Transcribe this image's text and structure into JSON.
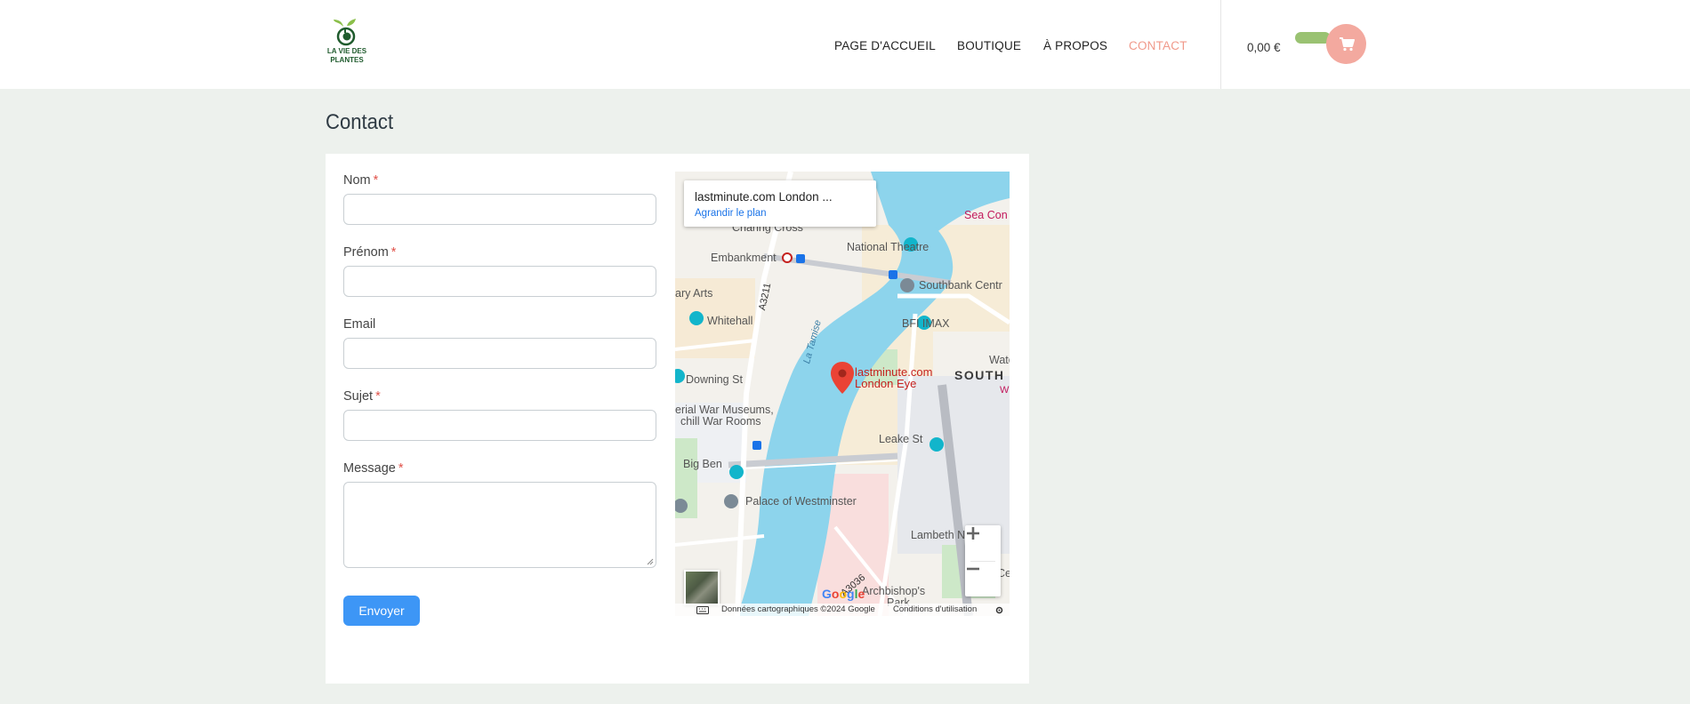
{
  "header": {
    "logo": {
      "line1": "LA VIE DES",
      "line2": "PLANTES"
    },
    "nav": [
      {
        "label": "PAGE D'ACCUEIL",
        "active": false
      },
      {
        "label": "BOUTIQUE",
        "active": false
      },
      {
        "label": "À PROPOS",
        "active": false
      },
      {
        "label": "CONTACT",
        "active": true
      }
    ],
    "cart_total": "0,00 €",
    "cart_icon": "shopping-cart-icon"
  },
  "page": {
    "title": "Contact"
  },
  "form": {
    "fields": [
      {
        "label": "Nom",
        "required": true
      },
      {
        "label": "Prénom",
        "required": true
      },
      {
        "label": "Email",
        "required": false
      },
      {
        "label": "Sujet",
        "required": true
      },
      {
        "label": "Message",
        "required": true
      }
    ],
    "required_mark": "*",
    "submit_label": "Envoyer"
  },
  "map": {
    "info_title": "lastminute.com London ...",
    "info_link": "Agrandir le plan",
    "places": {
      "charing_cross": "Charing Cross",
      "embankment": "Embankment",
      "national_theatre": "National Theatre",
      "sea_con": "Sea Con",
      "southbank": "Southbank Centr",
      "arts": "ary Arts",
      "whitehall": "Whitehall",
      "bfi": "BFI IMAX",
      "water": "Wate",
      "a3211": "A3211",
      "tamise": "La Tamise",
      "downing": "Downing St",
      "london_eye_1": "lastminute.com",
      "london_eye_2": "London Eye",
      "south": "SOUTH",
      "w": "W",
      "war_museums_1": "erial War Museums,",
      "war_museums_2": "chill War Rooms",
      "leake": "Leake St",
      "big_ben": "Big Ben",
      "westminster": "Palace of Westminster",
      "lambeth": "Lambeth N",
      "archbishop": "Archbishop's",
      "park": "Park",
      "a3036": "A3036",
      "cer": "Cer"
    },
    "google": "Google",
    "attribution_data": "Données cartographiques ©2024 Google",
    "attribution_terms": "Conditions d'utilisation",
    "zoom_in": "+",
    "zoom_out": "−"
  },
  "colors": {
    "accent": "#f0998a",
    "cart_circle": "#f3a99f",
    "cart_pill": "#9ac272",
    "button": "#3d96f6",
    "background": "#edf1ed",
    "river": "#8dd4ec"
  }
}
